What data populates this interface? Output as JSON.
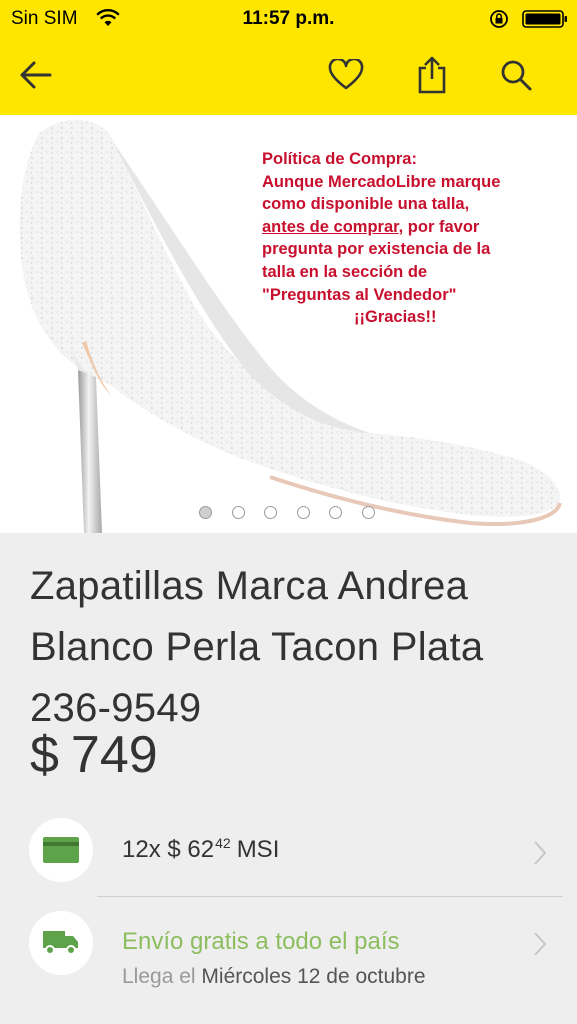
{
  "status_bar": {
    "carrier": "Sin SIM",
    "time": "11:57 p.m."
  },
  "navbar": {
    "icons": [
      "back-arrow-icon",
      "heart-icon",
      "share-icon",
      "search-icon"
    ]
  },
  "gallery": {
    "policy_lines": {
      "l1": "Política de Compra:",
      "l2": "Aunque MercadoLibre marque",
      "l3": "como disponible una talla,",
      "l4_underlined": "antes de comprar",
      "l4_rest": ", por favor",
      "l5": "pregunta por existencia de la",
      "l6": "talla en la sección de",
      "l7": "\"Preguntas al Vendedor\"",
      "l8": "¡¡Gracias!!"
    },
    "image_count": 6,
    "current_image": 1,
    "policy_color": "#c8102e"
  },
  "product": {
    "title_line1": "Zapatillas Marca Andrea",
    "title_line2": "Blanco Perla Tacon Plata",
    "title_line3": "236-9549",
    "price_currency": "$",
    "price_amount": "749"
  },
  "installments": {
    "icon": "credit-card-icon",
    "count_text": "12x",
    "currency": "$",
    "amount_int": "62",
    "amount_dec": "42",
    "suffix": "MSI"
  },
  "shipping": {
    "icon": "truck-icon",
    "title": "Envío gratis a todo el país",
    "arrives_prefix": "Llega el",
    "arrives_date": "Miércoles 12 de octubre",
    "accent": "#8cbd5e"
  },
  "theme": {
    "header_yellow": "#ffe600",
    "card_green": "#5ea34a"
  }
}
